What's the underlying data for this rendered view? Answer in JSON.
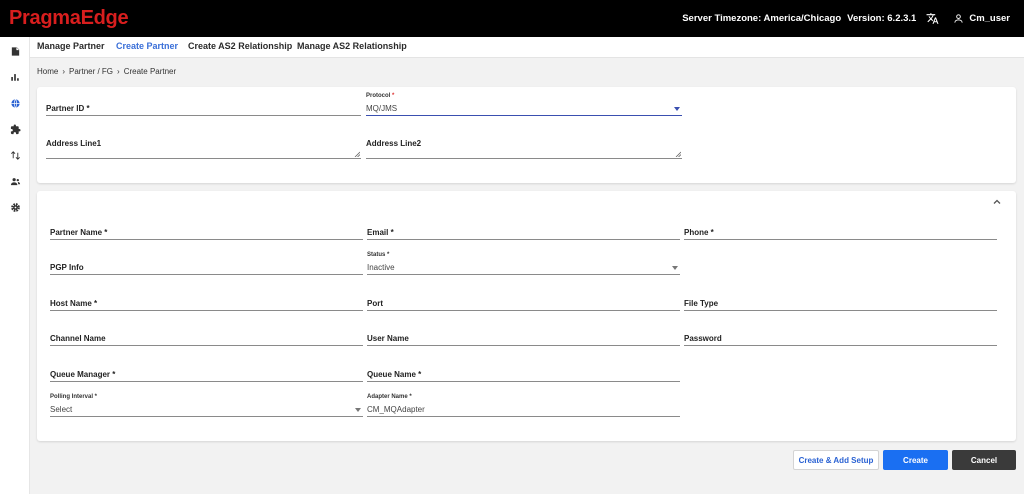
{
  "header": {
    "logo_part1": "Pragma",
    "logo_part2": "Edge",
    "timezone_text": "Server Timezone: America/Chicago",
    "version_text": "Version: 6.2.3.1",
    "username": "Cm_user",
    "colors": {
      "bar": "#000000",
      "logo": "#d81e1e"
    }
  },
  "sidebar": {
    "icons": [
      "file-icon",
      "bar-chart-icon",
      "globe-icon",
      "puzzle-icon",
      "swap-icon",
      "users-icon",
      "gear-icon"
    ],
    "active_icon": "globe-icon"
  },
  "nav": {
    "tabs": [
      {
        "label": "Manage Partner",
        "active": false
      },
      {
        "label": "Create Partner",
        "active": true
      },
      {
        "label": "Create AS2 Relationship",
        "active": false
      },
      {
        "label": "Manage AS2 Relationship",
        "active": false
      }
    ],
    "active_color": "#3a6fd8"
  },
  "breadcrumb": {
    "items": [
      "Home",
      "Partner / FG",
      "Create Partner"
    ]
  },
  "form_top": {
    "partner_id_label": "Partner ID *",
    "protocol_label": "Protocol",
    "protocol_value": "MQ/JMS",
    "address1_label": "Address Line1",
    "address2_label": "Address Line2"
  },
  "form_details": {
    "partner_name_label": "Partner Name *",
    "email_label": "Email *",
    "phone_label": "Phone *",
    "pgp_info_label": "PGP Info",
    "status_label": "Status *",
    "status_value": "Inactive",
    "host_name_label": "Host Name *",
    "port_label": "Port",
    "file_type_label": "File Type",
    "channel_name_label": "Channel Name",
    "user_name_label": "User Name",
    "password_label": "Password",
    "queue_manager_label": "Queue Manager *",
    "queue_name_label": "Queue Name *",
    "polling_interval_label": "Polling Interval *",
    "polling_interval_value": "Select",
    "adapter_name_label": "Adapter Name *",
    "adapter_name_value": "CM_MQAdapter"
  },
  "actions": {
    "create_add_setup": "Create & Add Setup",
    "create": "Create",
    "cancel": "Cancel",
    "colors": {
      "primary": "#1a6ff2",
      "dark": "#3a3a3a"
    }
  }
}
